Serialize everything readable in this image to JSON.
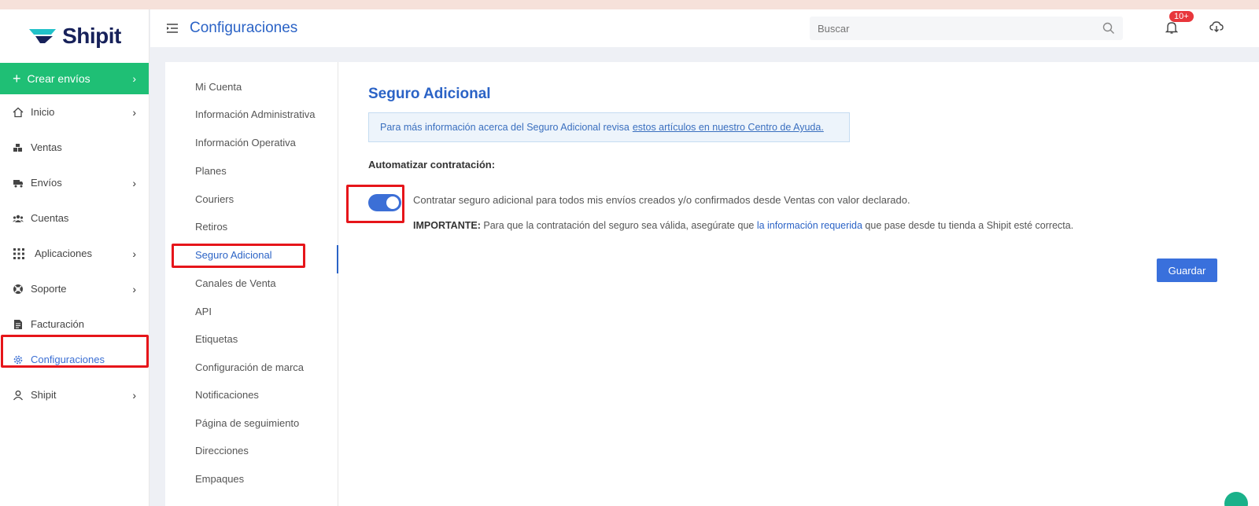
{
  "app": {
    "logo_text": "Shipit"
  },
  "sidebar": {
    "create": {
      "label": "Crear envíos"
    },
    "items": [
      {
        "label": "Inicio",
        "icon": "home-icon",
        "has_chevron": true
      },
      {
        "label": "Ventas",
        "icon": "boxes-icon",
        "has_chevron": false
      },
      {
        "label": "Envíos",
        "icon": "truck-icon",
        "has_chevron": true
      },
      {
        "label": "Cuentas",
        "icon": "users-icon",
        "has_chevron": false
      },
      {
        "label": "Aplicaciones",
        "icon": "grid-icon",
        "has_chevron": true
      },
      {
        "label": "Soporte",
        "icon": "lifebuoy-icon",
        "has_chevron": true
      },
      {
        "label": "Facturación",
        "icon": "document-icon",
        "has_chevron": false
      },
      {
        "label": "Configuraciones",
        "icon": "gear-icon",
        "has_chevron": false,
        "active": true
      },
      {
        "label": "Shipit",
        "icon": "user-icon",
        "has_chevron": true
      }
    ]
  },
  "header": {
    "title": "Configuraciones",
    "search_placeholder": "Buscar",
    "notification_badge": "10+"
  },
  "submenu": {
    "items": [
      "Mi Cuenta",
      "Información Administrativa",
      "Información Operativa",
      "Planes",
      "Couriers",
      "Retiros",
      "Seguro Adicional",
      "Canales de Venta",
      "API",
      "Etiquetas",
      "Configuración de marca",
      "Notificaciones",
      "Página de seguimiento",
      "Direcciones",
      "Empaques"
    ],
    "active": "Seguro Adicional"
  },
  "content": {
    "title": "Seguro Adicional",
    "info_text": "Para más información acerca del Seguro Adicional revisa",
    "info_link": "estos artículos en nuestro Centro de Ayuda.",
    "auto_label": "Automatizar contratación:",
    "toggle_on": true,
    "option_text": "Contratar seguro adicional para todos mis envíos creados y/o confirmados desde Ventas con valor declarado.",
    "important_label": "IMPORTANTE:",
    "important_text_1": "Para que la contratación del seguro sea válida, asegúrate que",
    "important_link": "la información requerida",
    "important_text_2": "que pase desde tu tienda a Shipit esté correcta.",
    "save_label": "Guardar"
  },
  "colors": {
    "brand_green": "#1fbf75",
    "accent_blue": "#2b63c6",
    "highlight_red": "#e6151a"
  }
}
